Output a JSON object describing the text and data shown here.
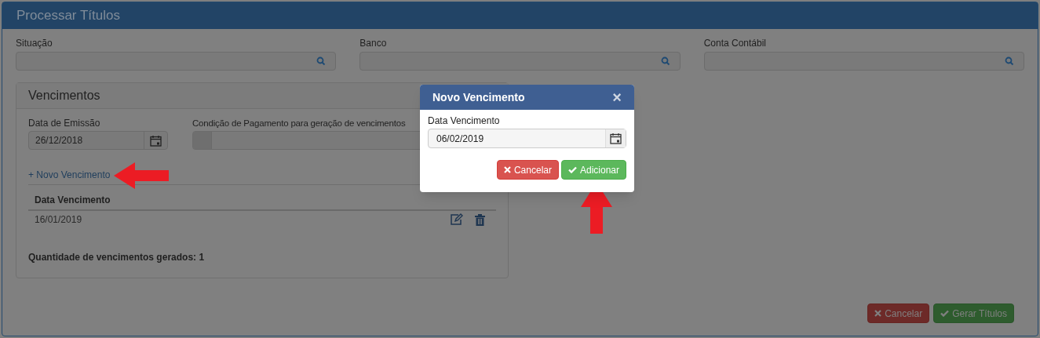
{
  "window": {
    "title": "Processar Títulos"
  },
  "filters": [
    {
      "label": "Situação"
    },
    {
      "label": "Banco"
    },
    {
      "label": "Conta Contábil"
    }
  ],
  "vencimentos": {
    "title": "Vencimentos",
    "emissao": {
      "label": "Data de Emissão",
      "value": "26/12/2018"
    },
    "condicao": {
      "label": "Condição de Pagamento para geração de vencimentos"
    },
    "add_link": "+ Novo Vencimento",
    "columns": [
      "Data Vencimento"
    ],
    "rows": [
      {
        "date": "16/01/2019"
      }
    ],
    "count": "Quantidade de vencimentos gerados: 1"
  },
  "footer_buttons": [
    {
      "kind": "cancel",
      "label": "Cancelar"
    },
    {
      "kind": "confirm",
      "label": "Gerar Títulos"
    }
  ],
  "modal": {
    "title": "Novo Vencimento",
    "close": "×",
    "field": {
      "label": "Data Vencimento",
      "value": "06/02/2019"
    },
    "buttons": [
      {
        "kind": "cancel",
        "label": "Cancelar"
      },
      {
        "kind": "confirm",
        "label": "Adicionar"
      }
    ]
  }
}
